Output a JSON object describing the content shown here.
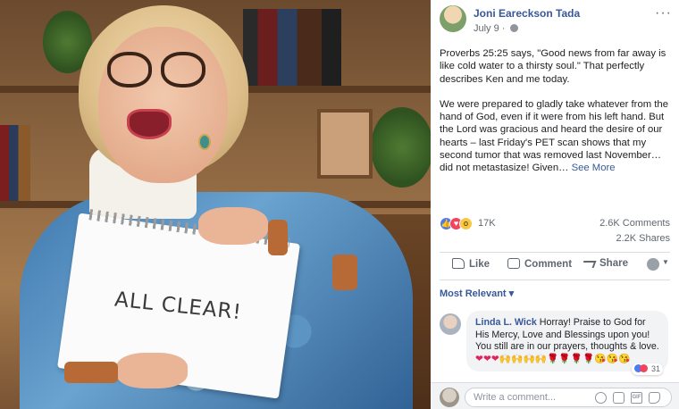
{
  "photo": {
    "sign_text": "ALL CLEAR!"
  },
  "post": {
    "author": "Joni Eareckson Tada",
    "date": "July 9 ·",
    "paragraph1": "Proverbs 25:25 says, \"Good news from far away is like cold water to a thirsty soul.\" That perfectly describes Ken and me today.",
    "paragraph2": "We were prepared to gladly take whatever from the hand of God, even if it were from his left hand. But the Lord was gracious and heard the desire of our hearts – last Friday's PET scan shows that my second tumor that was removed last November… did not metastasize! Given…",
    "see_more": "See More",
    "more_options": "···"
  },
  "stats": {
    "reaction_icons": [
      "like-icon",
      "love-icon",
      "wow-icon"
    ],
    "reaction_count": "17K",
    "comments": "2.6K Comments",
    "shares": "2.2K Shares"
  },
  "actions": {
    "like": "Like",
    "comment": "Comment",
    "share": "Share"
  },
  "comments_filter": "Most Relevant ▾",
  "comment": {
    "author": "Linda L. Wick",
    "text": "Horray! Praise to God for His Mercy, Love and Blessings upon you! You still are in our prayers, thoughts & love.",
    "emoji_hearts": "❤❤❤",
    "emoji_hands": "🙌🙌🙌🙌",
    "emoji_roses": "🌹🌹🌹🌹",
    "emoji_kisses": "😘😘😘",
    "reaction_count": "31"
  },
  "composer": {
    "placeholder": "Write a comment...",
    "icons": [
      "emoji-icon",
      "camera-icon",
      "gif-icon",
      "sticker-icon"
    ]
  },
  "colors": {
    "link": "#385898",
    "muted": "#606770",
    "like_blue": "#4a7cf0",
    "love_red": "#f0445f"
  }
}
